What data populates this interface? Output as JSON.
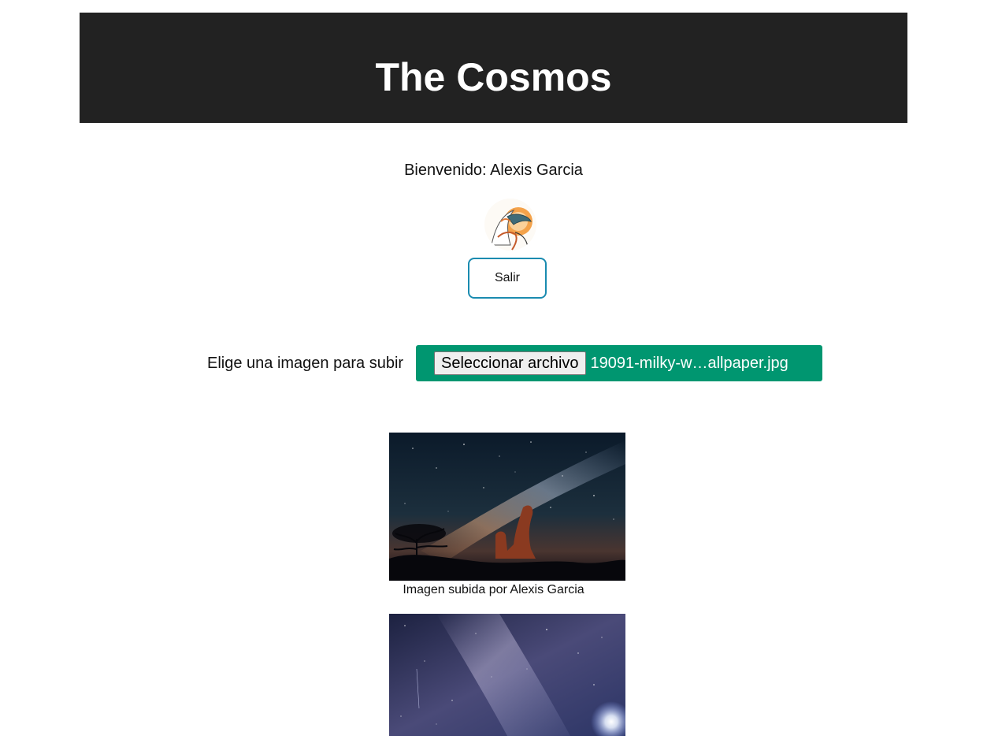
{
  "header": {
    "title": "The Cosmos"
  },
  "user": {
    "welcome": "Bienvenido: Alexis Garcia",
    "avatar_icon": "phoenix-avatar-icon"
  },
  "logout": {
    "label": "Salir"
  },
  "upload": {
    "label": "Elige una imagen para subir",
    "button_label": "Seleccionar archivo",
    "file_name": "19091-milky-w…allpaper.jpg",
    "accent_color": "#009670"
  },
  "gallery": {
    "items": [
      {
        "caption": "Imagen subida por Alexis Garcia",
        "scene": "milky-way-over-rock-formation"
      },
      {
        "caption": "",
        "scene": "milky-way-purple-sky"
      }
    ]
  },
  "colors": {
    "header_bg": "#222222",
    "button_border": "#1a8bb0"
  }
}
